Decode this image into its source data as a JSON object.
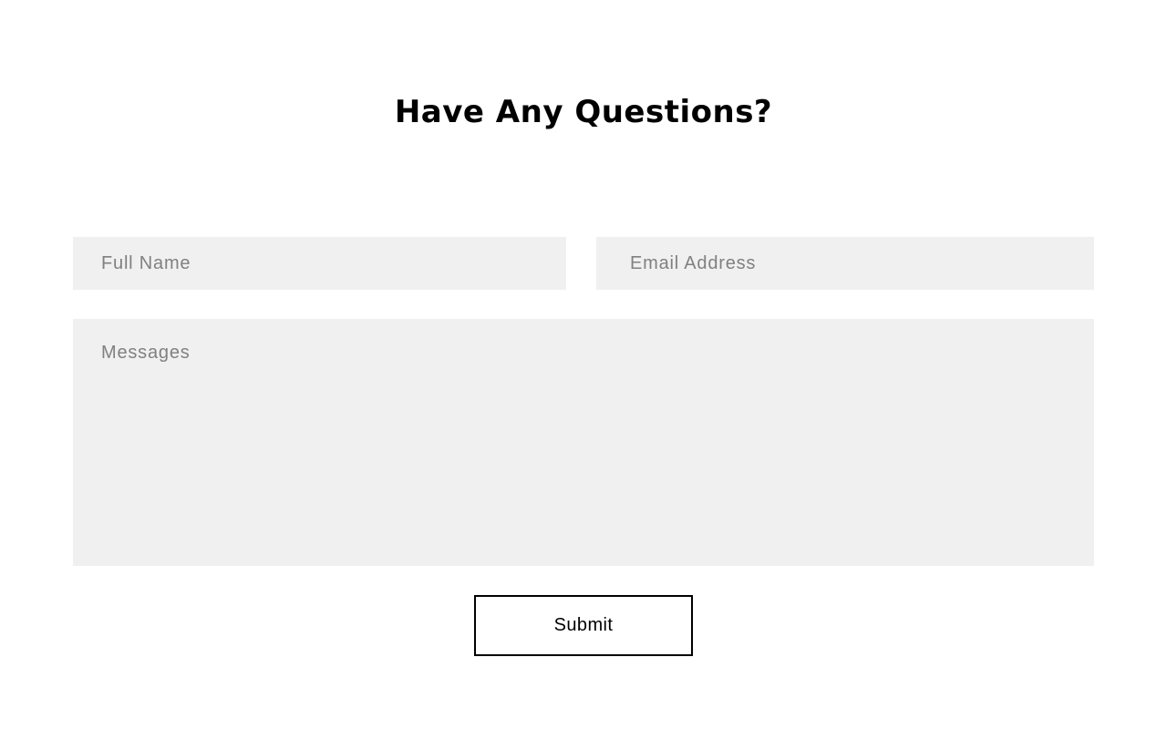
{
  "contact_form": {
    "heading": "Have Any Questions?",
    "full_name": {
      "value": "",
      "placeholder": "Full Name"
    },
    "email": {
      "value": "",
      "placeholder": "Email Address"
    },
    "message": {
      "value": "",
      "placeholder": "Messages"
    },
    "submit_label": "Submit"
  },
  "colors": {
    "background": "#ffffff",
    "field_background": "#f0f0f0",
    "placeholder_text": "#808080",
    "text": "#000000",
    "button_border": "#000000"
  }
}
